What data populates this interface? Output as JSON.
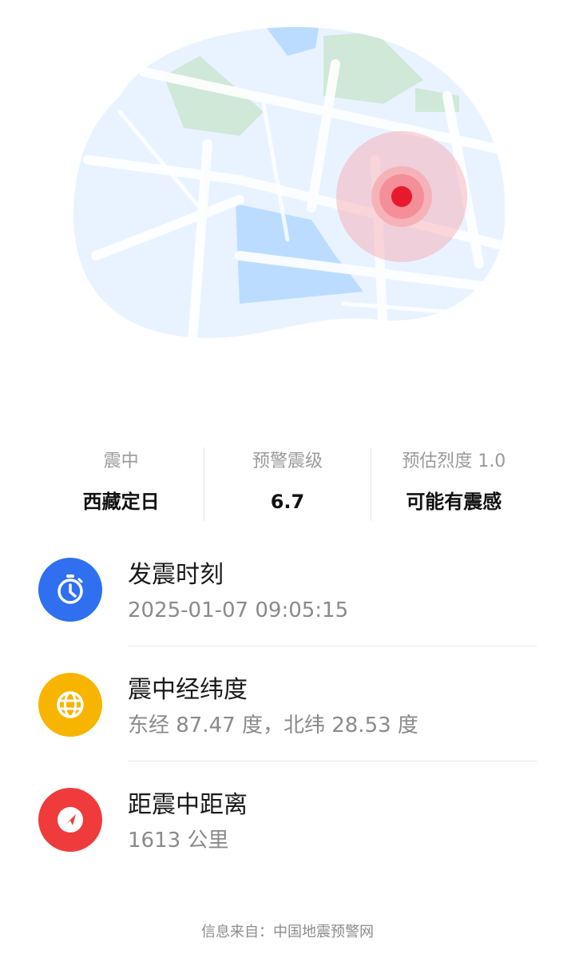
{
  "summary": {
    "epicenter_label": "震中",
    "epicenter_value": "西藏定日",
    "magnitude_label": "预警震级",
    "magnitude_value": "6.7",
    "intensity_label": "预估烈度 1.0",
    "intensity_value": "可能有震感"
  },
  "details": [
    {
      "title": "发震时刻",
      "value": "2025-01-07 09:05:15",
      "icon": "clock-icon",
      "color": "#2f6ff0"
    },
    {
      "title": "震中经纬度",
      "value": "东经 87.47 度，北纬 28.53 度",
      "icon": "globe-icon",
      "color": "#f7b500"
    },
    {
      "title": "距震中距离",
      "value": "1613 公里",
      "icon": "navigation-arrow-icon",
      "color": "#ef3b3b"
    }
  ],
  "footer": {
    "source": "信息来自：中国地震预警网"
  },
  "colors": {
    "map_water": "#bcdcff",
    "map_land": "#e9f3ff",
    "map_park": "#cfe8d8",
    "epicenter_red": "#e8192c"
  }
}
